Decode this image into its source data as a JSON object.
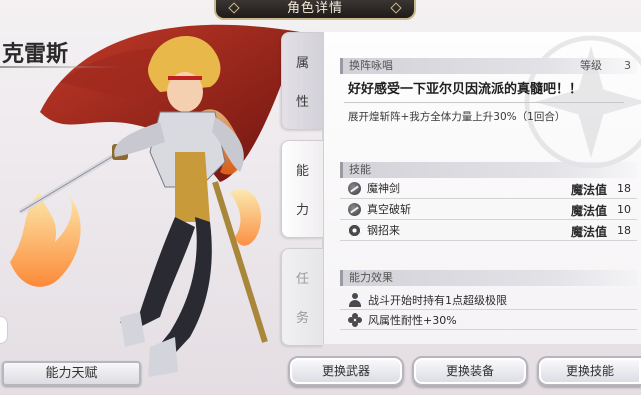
{
  "header": {
    "title": "角色详情"
  },
  "character": {
    "name": "克雷斯"
  },
  "left": {
    "talent_button": "能力天赋"
  },
  "tabs": [
    {
      "chars": [
        "属",
        "性"
      ],
      "state": "active"
    },
    {
      "chars": [
        "能",
        "力"
      ],
      "state": "normal"
    },
    {
      "chars": [
        "任",
        "务"
      ],
      "state": "disabled"
    }
  ],
  "formation": {
    "heading": "换阵咏唱",
    "level_label": "等级",
    "level_value": "3",
    "slogan": "好好感受一下亚尔贝因流派的真髓吧！！",
    "effect": "展开煌斩阵+我方全体力量上升30%（1回合）"
  },
  "skills": {
    "heading": "技能",
    "items": [
      {
        "icon": "sword-orb-icon",
        "name": "魔神剑",
        "cost_label": "魔法值",
        "cost": "18"
      },
      {
        "icon": "sword-orb-icon",
        "name": "真空破斩",
        "cost_label": "魔法值",
        "cost": "10"
      },
      {
        "icon": "gear-icon",
        "name": "钢招来",
        "cost_label": "魔法值",
        "cost": "18"
      }
    ]
  },
  "abilities": {
    "heading": "能力效果",
    "items": [
      {
        "icon": "person-icon",
        "text": "战斗开始时持有1点超级极限"
      },
      {
        "icon": "clover-icon",
        "text": "风属性耐性+30%"
      }
    ]
  },
  "buttons": {
    "weapon": "更换武器",
    "equip": "更换装备",
    "skill": "更换技能"
  },
  "colors": {
    "title_bar": "#1e1b1a",
    "gold_border": "#c9b98c",
    "panel": "#f6f4f6"
  }
}
